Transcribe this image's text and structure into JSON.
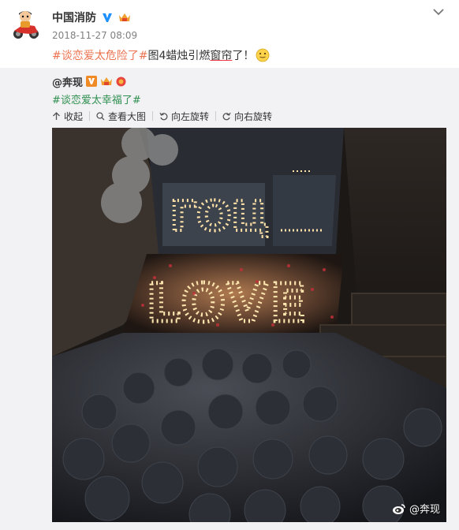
{
  "post": {
    "author": "中国消防",
    "timestamp": "2018-11-27 08:09",
    "text": {
      "hashtag": "#谈恋爱太危险了#",
      "before": "图4蜡烛引燃",
      "underlined": "窗帘",
      "after": "了！"
    }
  },
  "repost": {
    "author": "@奔现",
    "hashtag": "#谈恋爱太幸福了#",
    "toolbar": {
      "collapse": "收起",
      "view_large": "查看大图",
      "rotate_left": "向左旋转",
      "rotate_right": "向右旋转"
    },
    "image": {
      "letters": "LOVE",
      "window_text": "ГОЦ",
      "watermark": "@奔现"
    }
  },
  "colors": {
    "hashtag_orange": "#eb7350",
    "hashtag_green": "#2f8f4e",
    "verified_blue": "#1e90ff",
    "repost_bg": "#f2f2f5"
  },
  "icons": [
    "avatar-icon",
    "verified-icon",
    "vip-icon",
    "chevron-down-icon",
    "smile-emoji-icon",
    "collapse-icon",
    "view-large-icon",
    "rotate-left-icon",
    "rotate-right-icon",
    "weibo-logo-icon"
  ]
}
